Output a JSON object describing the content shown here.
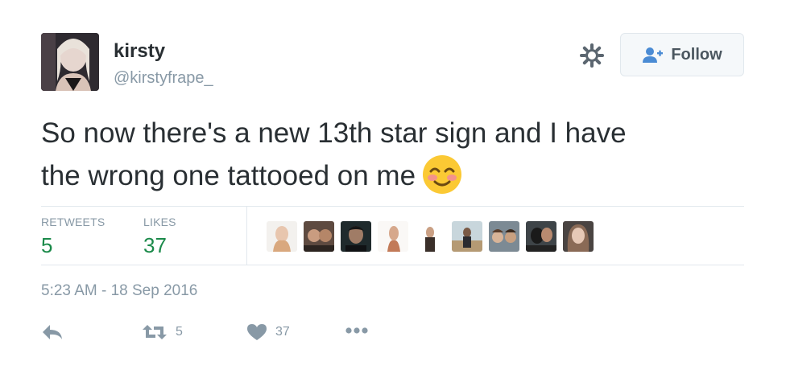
{
  "user": {
    "display_name": "kirsty",
    "handle": "@kirstyfrape_",
    "avatar_icon": "profile-photo"
  },
  "follow_button": {
    "label": "Follow",
    "icon": "add-user-icon",
    "color": "#4a8bd4"
  },
  "settings_icon": "gear-icon",
  "tweet": {
    "line1": "So now there's a new 13th star sign and I have",
    "line2": "the wrong one tattooed on me",
    "emoji": "smiling-face-with-blush"
  },
  "stats": {
    "retweets_label": "RETWEETS",
    "retweets_value": "5",
    "likes_label": "LIKES",
    "likes_value": "37",
    "value_color": "#1b8a4a"
  },
  "likers": [
    {
      "icon": "liker-avatar-1"
    },
    {
      "icon": "liker-avatar-2"
    },
    {
      "icon": "liker-avatar-3"
    },
    {
      "icon": "liker-avatar-4"
    },
    {
      "icon": "liker-avatar-5"
    },
    {
      "icon": "liker-avatar-6"
    },
    {
      "icon": "liker-avatar-7"
    },
    {
      "icon": "liker-avatar-8"
    },
    {
      "icon": "liker-avatar-9"
    }
  ],
  "timestamp": "5:23 AM - 18 Sep 2016",
  "actions": {
    "reply_icon": "reply-icon",
    "retweet_icon": "retweet-icon",
    "retweet_count": "5",
    "like_icon": "heart-icon",
    "like_count": "37",
    "more_icon": "more-icon"
  }
}
